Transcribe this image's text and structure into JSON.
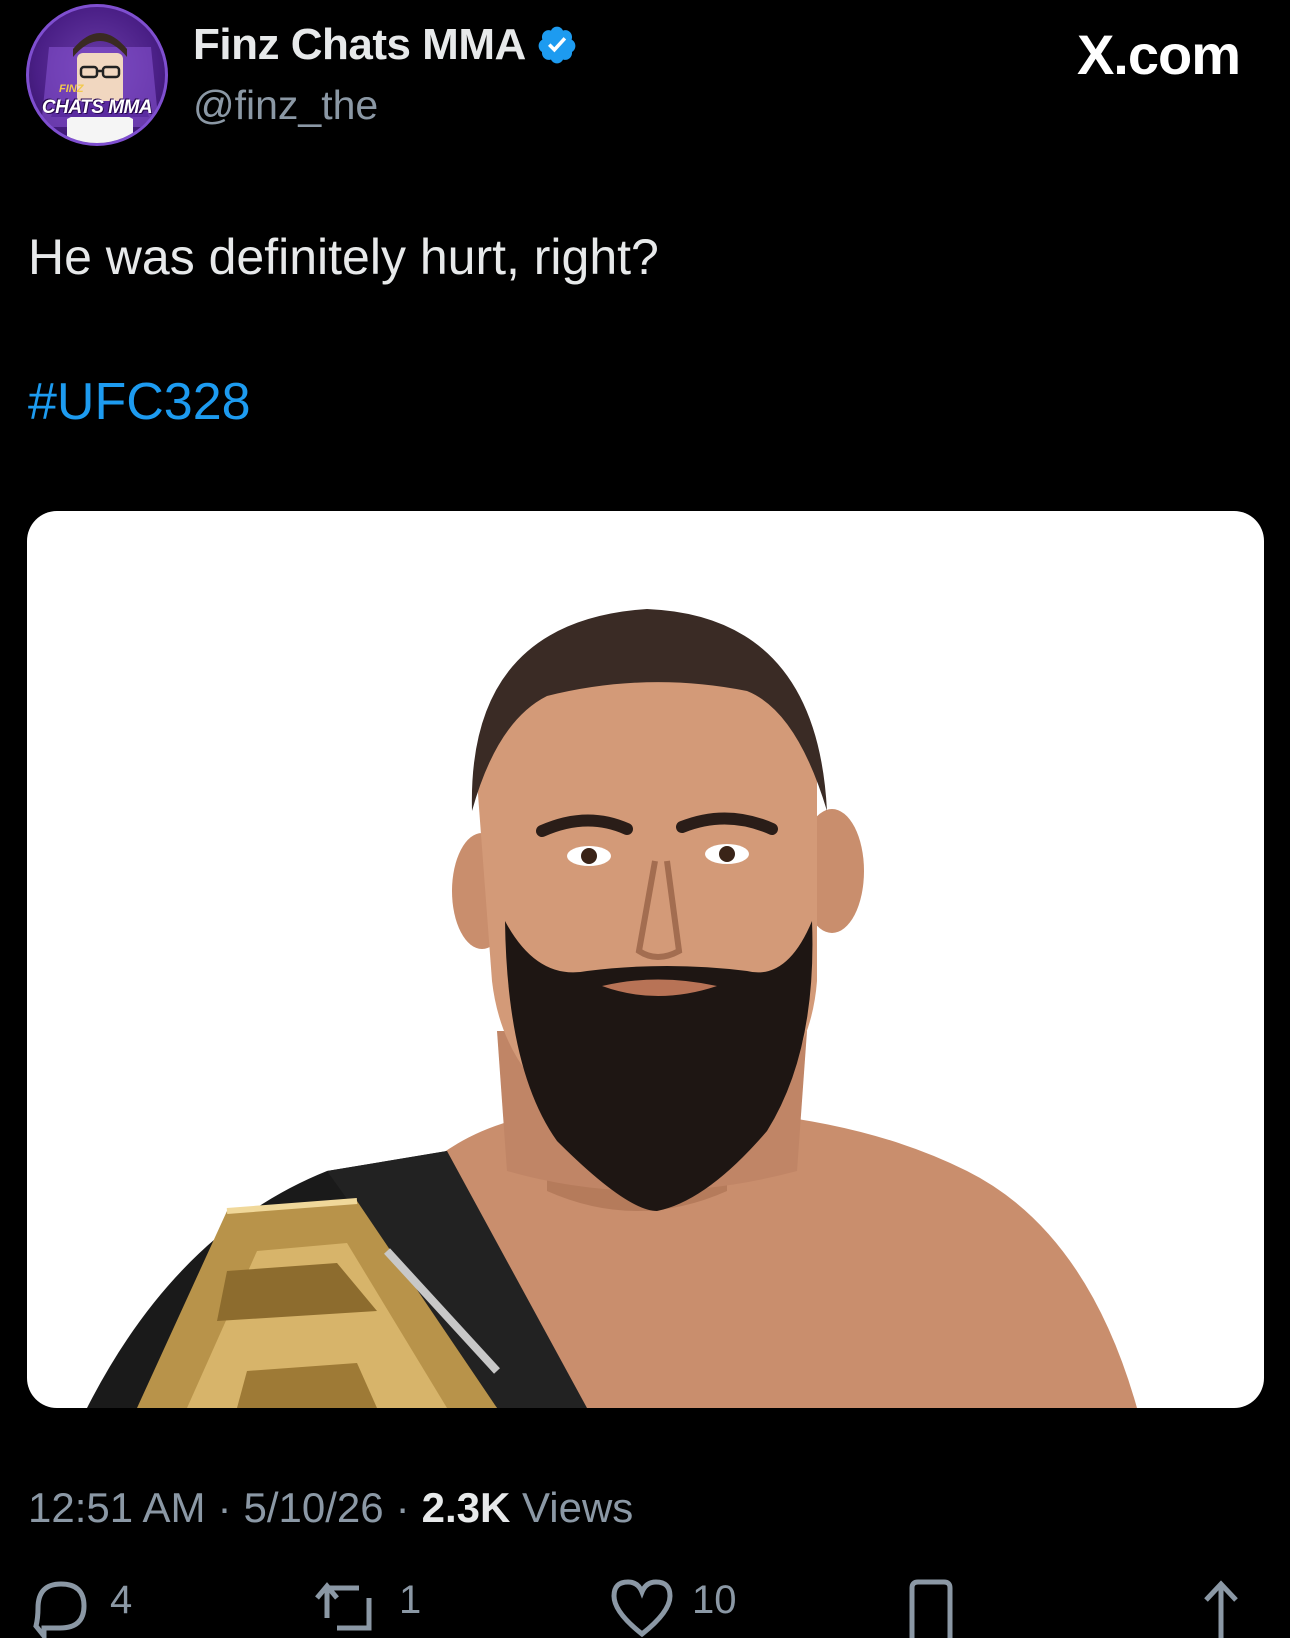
{
  "header": {
    "display_name": "Finz Chats MMA",
    "handle": "@finz_the",
    "verified_icon": "verified-badge-icon",
    "site_logo": "X.com",
    "avatar_text": "CHATS MMA",
    "avatar_small_text": "FINZ"
  },
  "tweet": {
    "text": "He was definitely hurt, right?",
    "hashtag": "#UFC328",
    "media_alt": "Photo of a bearded MMA fighter holding a championship belt"
  },
  "meta": {
    "time": "12:51 AM",
    "separator": "·",
    "date": "5/10/26",
    "views_count": "2.3K",
    "views_label": "Views"
  },
  "actions": {
    "reply_count": "4",
    "repost_count": "1",
    "like_count": "10"
  },
  "colors": {
    "background": "#000000",
    "text": "#e7e9ea",
    "secondary": "#8b98a5",
    "link": "#1d9bf0",
    "verified": "#1d9bf0"
  }
}
